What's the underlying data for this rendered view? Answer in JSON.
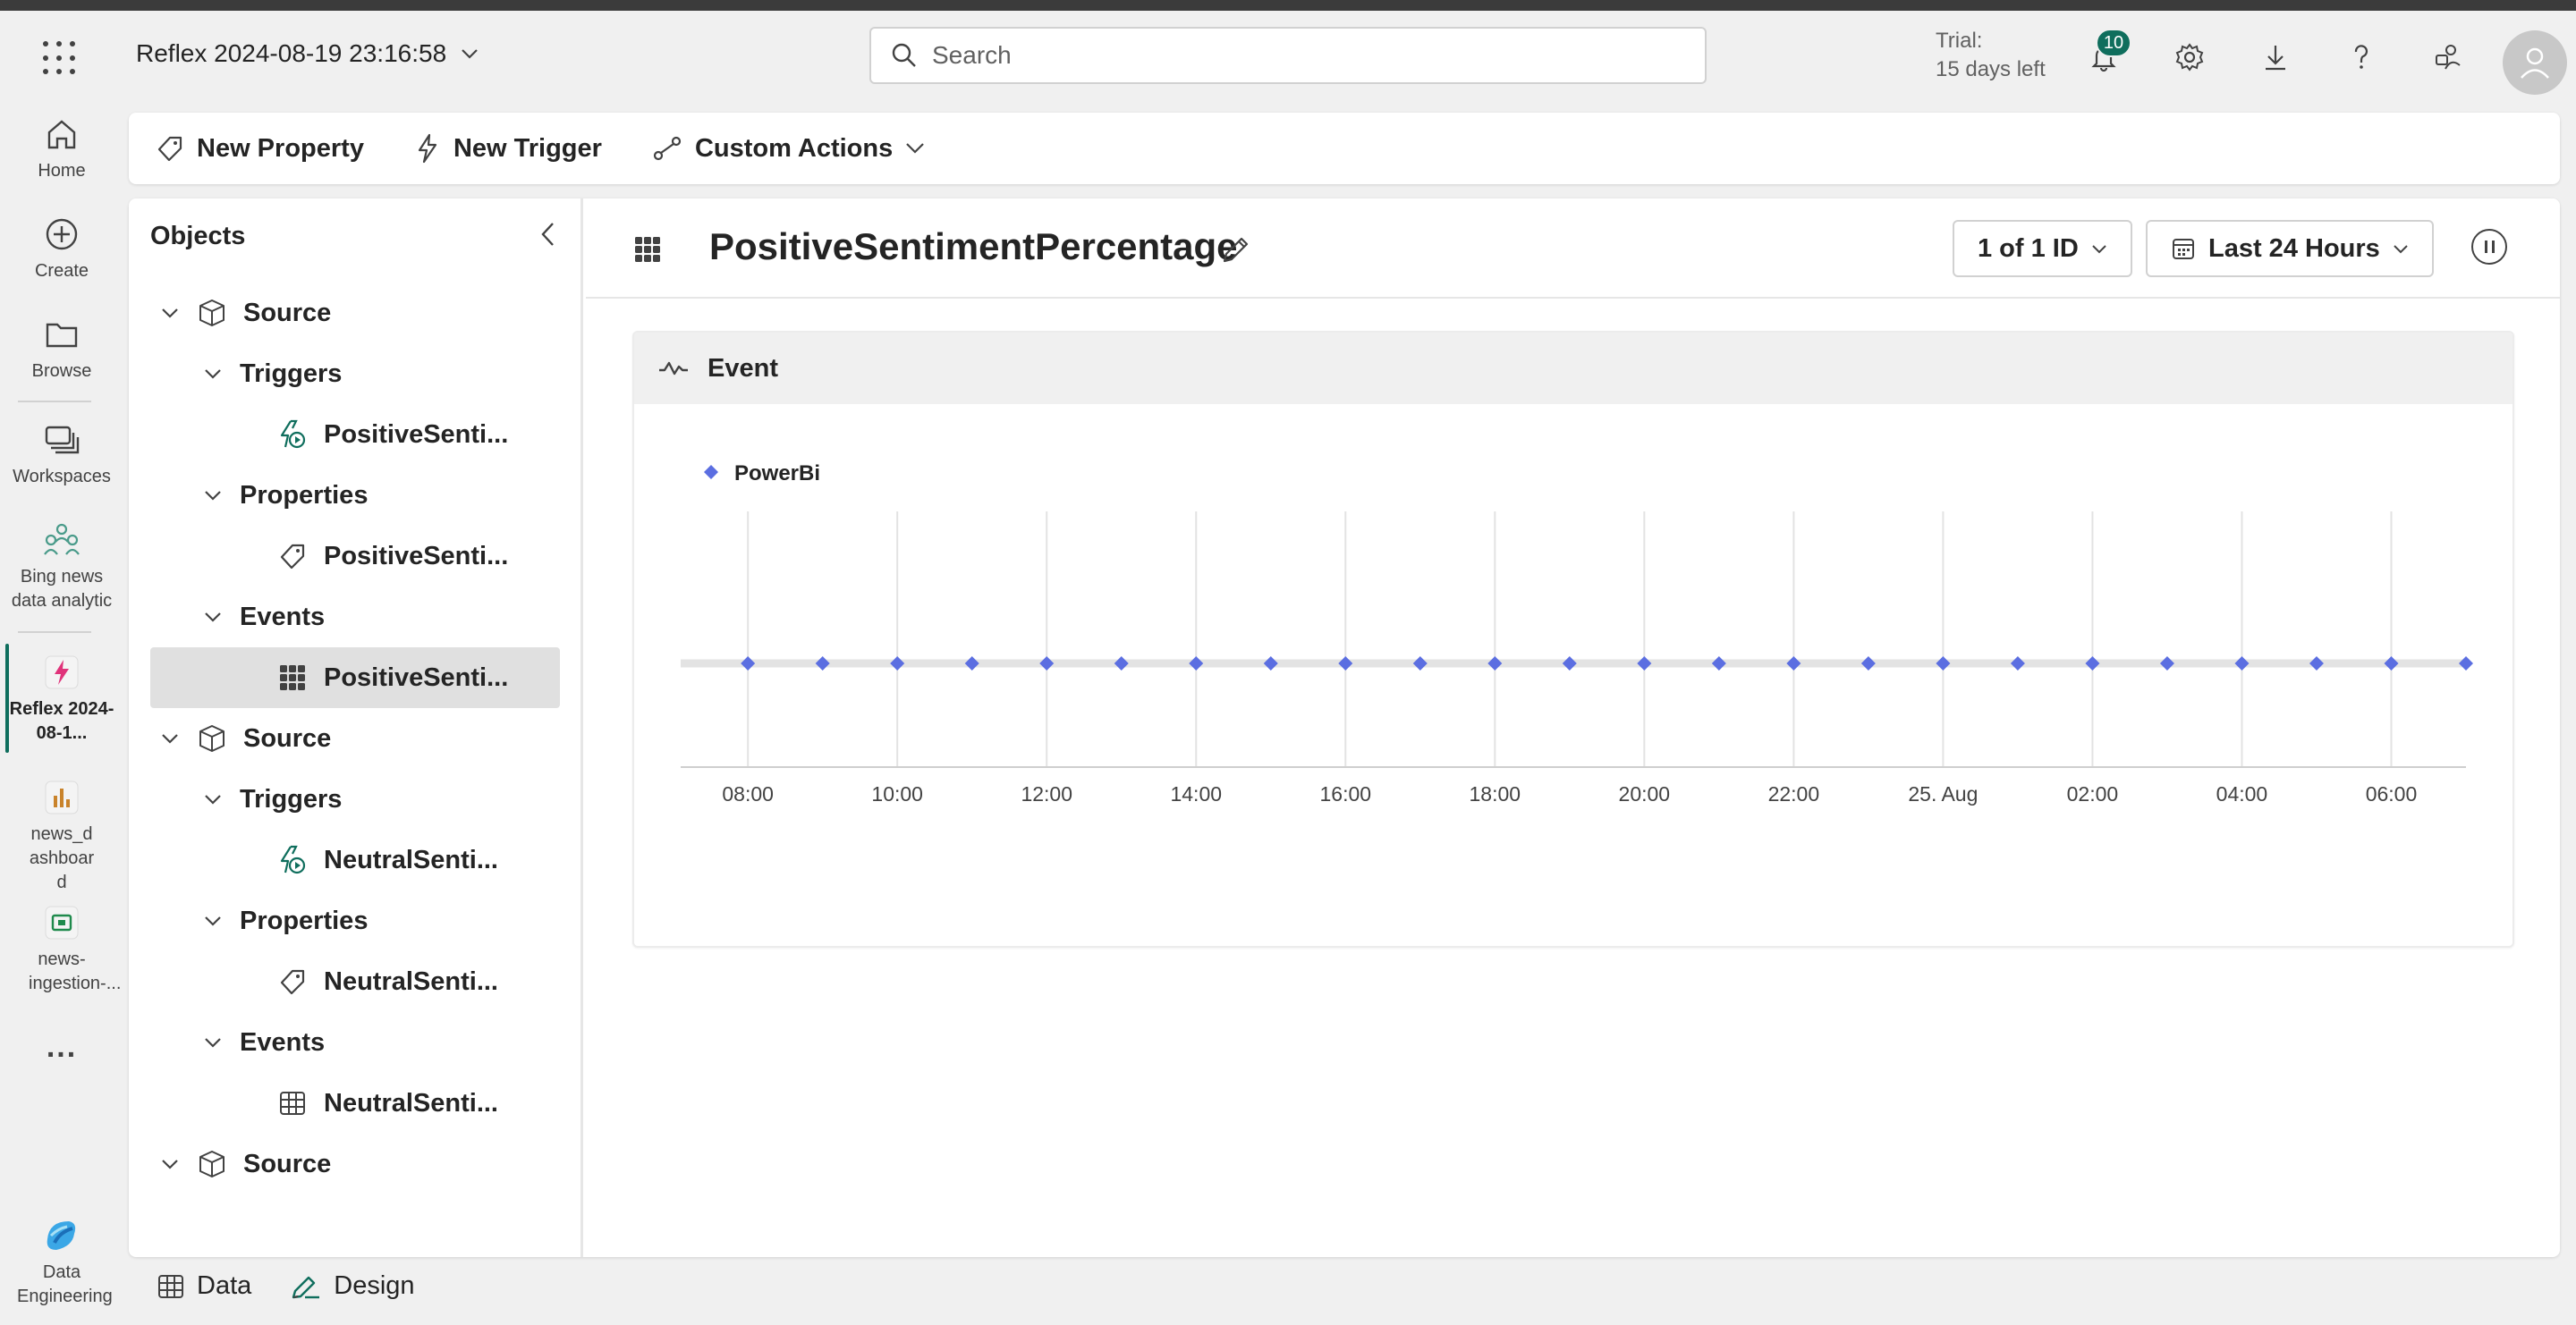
{
  "header": {
    "app_title": "Reflex 2024-08-19 23:16:58",
    "search_placeholder": "Search",
    "trial_line1": "Trial:",
    "trial_line2": "15 days left",
    "notifications_count": "10"
  },
  "rail": {
    "items": [
      {
        "label": "Home",
        "icon": "home-icon"
      },
      {
        "label": "Create",
        "icon": "plus-circle-icon"
      },
      {
        "label": "Browse",
        "icon": "folder-icon"
      },
      {
        "label": "Workspaces",
        "icon": "workspaces-icon"
      },
      {
        "label": "Bing news data analytic",
        "icon": "group-icon"
      },
      {
        "label": "Reflex 2024-08-1...",
        "icon": "reflex-icon"
      },
      {
        "label": "news_dashboard",
        "icon": "report-icon"
      },
      {
        "label": "news-ingestion-...",
        "icon": "pipeline-icon"
      },
      {
        "label": "...",
        "icon": "more-icon"
      },
      {
        "label": "Data Engineering",
        "icon": "data-engineering-icon"
      }
    ]
  },
  "toolbar": {
    "new_property": "New Property",
    "new_trigger": "New Trigger",
    "custom_actions": "Custom Actions"
  },
  "objects": {
    "title": "Objects",
    "tree": [
      {
        "label": "Source",
        "level": 0,
        "icon": "cube-icon"
      },
      {
        "label": "Triggers",
        "level": 1
      },
      {
        "label": "PositiveSenti...",
        "level": 2,
        "icon": "trigger-icon"
      },
      {
        "label": "Properties",
        "level": 1
      },
      {
        "label": "PositiveSenti...",
        "level": 2,
        "icon": "tag-icon"
      },
      {
        "label": "Events",
        "level": 1
      },
      {
        "label": "PositiveSenti...",
        "level": 2,
        "icon": "grid-icon",
        "selected": true
      },
      {
        "label": "Source",
        "level": 0,
        "icon": "cube-icon"
      },
      {
        "label": "Triggers",
        "level": 1
      },
      {
        "label": "NeutralSenti...",
        "level": 2,
        "icon": "trigger-icon"
      },
      {
        "label": "Properties",
        "level": 1
      },
      {
        "label": "NeutralSenti...",
        "level": 2,
        "icon": "tag-icon"
      },
      {
        "label": "Events",
        "level": 1
      },
      {
        "label": "NeutralSenti...",
        "level": 2,
        "icon": "table-icon"
      },
      {
        "label": "Source",
        "level": 0,
        "icon": "cube-icon"
      }
    ]
  },
  "detail": {
    "title": "PositiveSentimentPercentage",
    "id_filter": "1 of 1 ID",
    "time_filter": "Last 24 Hours",
    "event_label": "Event"
  },
  "chart_data": {
    "type": "scatter",
    "series": [
      {
        "name": "PowerBi",
        "color": "#5b6ee1",
        "x_hours": [
          8,
          9,
          10,
          11,
          12,
          13,
          14,
          15,
          16,
          17,
          18,
          19,
          20,
          21,
          22,
          23,
          24,
          25,
          26,
          27,
          28,
          29,
          30,
          31
        ]
      }
    ],
    "x_ticks": [
      "08:00",
      "10:00",
      "12:00",
      "14:00",
      "16:00",
      "18:00",
      "20:00",
      "22:00",
      "25. Aug",
      "02:00",
      "04:00",
      "06:00"
    ],
    "x_tick_hours": [
      8,
      10,
      12,
      14,
      16,
      18,
      20,
      22,
      24,
      26,
      28,
      30
    ],
    "xlim_hours": [
      7.1,
      31.0
    ],
    "ylabel": "",
    "xlabel": "",
    "grid": "vertical",
    "legend": "top-left"
  },
  "bottom": {
    "data_tab": "Data",
    "design_tab": "Design"
  }
}
